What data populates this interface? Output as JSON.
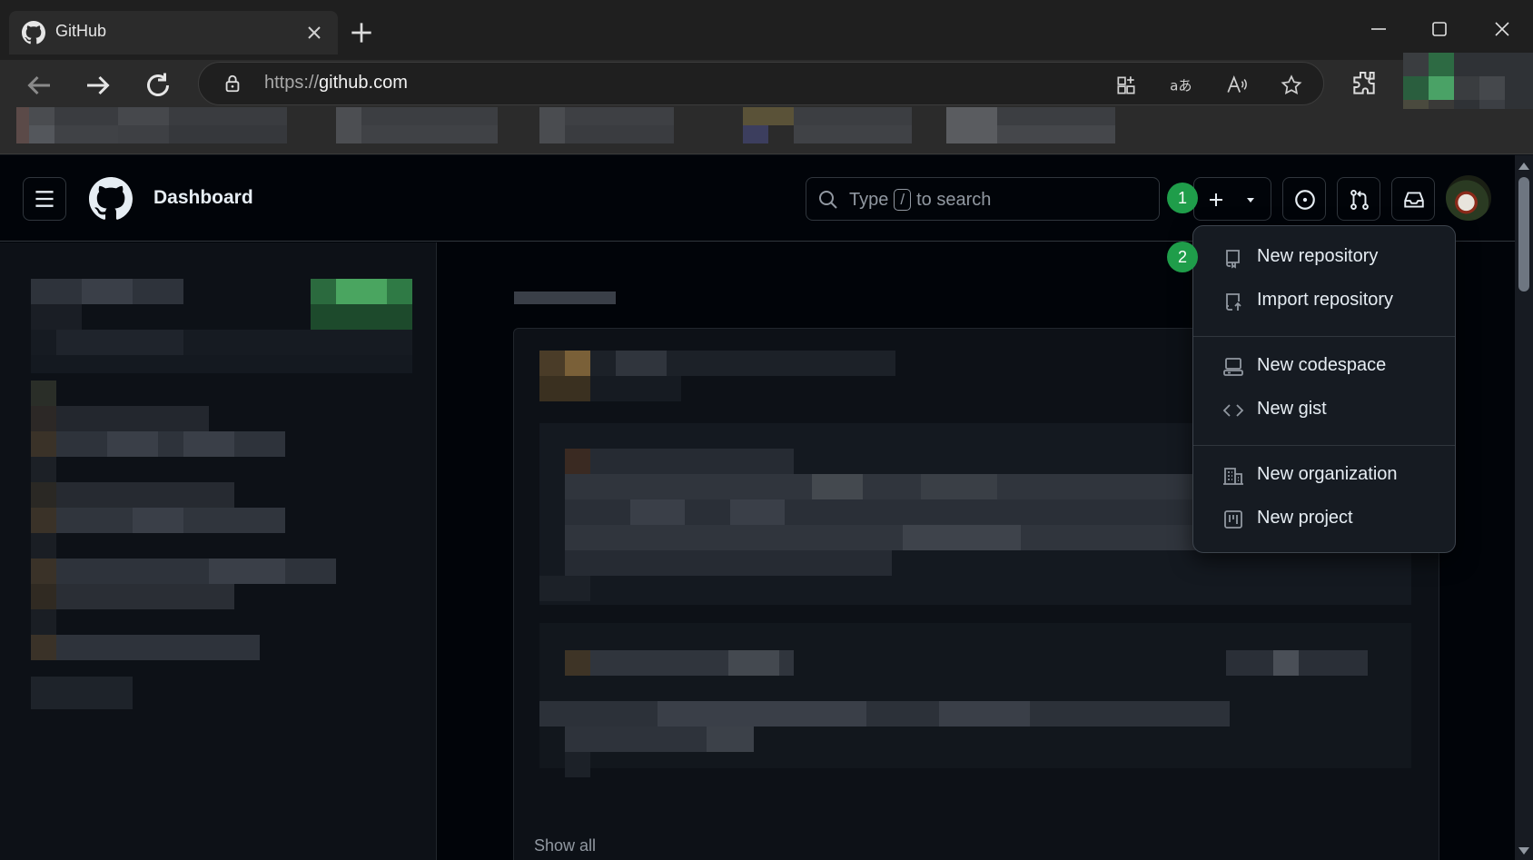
{
  "browser": {
    "tab_title": "GitHub",
    "url_scheme": "https://",
    "url_host": "github.com"
  },
  "github": {
    "header_title": "Dashboard",
    "search": {
      "prefix": "Type",
      "key": "/",
      "suffix": "to search"
    },
    "show_all": "Show all"
  },
  "create_menu": {
    "items": [
      {
        "label": "New repository",
        "icon": "repo-icon"
      },
      {
        "label": "Import repository",
        "icon": "repo-push-icon"
      },
      {
        "label": "New codespace",
        "icon": "codespaces-icon"
      },
      {
        "label": "New gist",
        "icon": "code-icon"
      },
      {
        "label": "New organization",
        "icon": "organization-icon"
      },
      {
        "label": "New project",
        "icon": "project-icon"
      }
    ]
  },
  "step_badges": [
    "1",
    "2"
  ],
  "colors": {
    "badge": "#1f9d4a",
    "page_bg": "#010409",
    "menu_bg": "#161b22"
  }
}
